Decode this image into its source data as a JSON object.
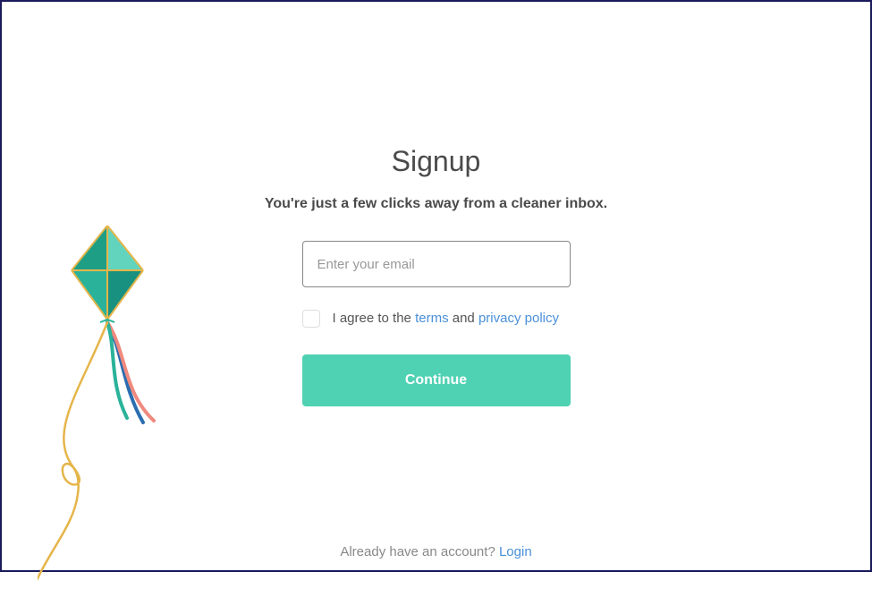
{
  "title": "Signup",
  "subtitle": "You're just a few clicks away from a cleaner inbox.",
  "email": {
    "placeholder": "Enter your email",
    "value": ""
  },
  "agree": {
    "prefix": "I agree to the ",
    "terms_label": "terms",
    "and": " and ",
    "privacy_label": "privacy policy"
  },
  "continue_label": "Continue",
  "login": {
    "prefix": "Already have an account? ",
    "link_label": "Login"
  },
  "colors": {
    "accent": "#4fd1b3",
    "link": "#4a90d9"
  }
}
